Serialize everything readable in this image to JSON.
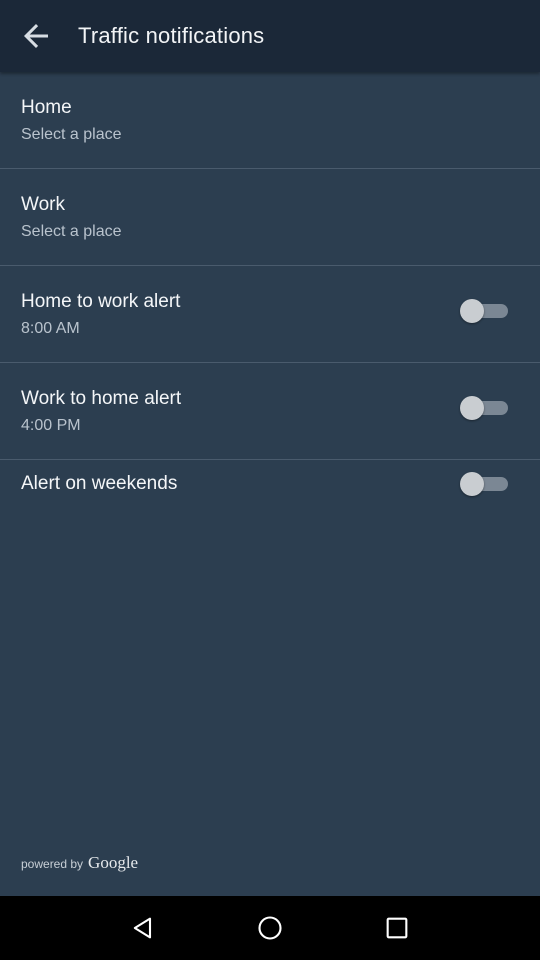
{
  "header": {
    "title": "Traffic notifications",
    "back_icon": "arrow-left-icon"
  },
  "settings": [
    {
      "id": "home",
      "primary": "Home",
      "secondary": "Select a place",
      "has_toggle": false
    },
    {
      "id": "work",
      "primary": "Work",
      "secondary": "Select a place",
      "has_toggle": false
    },
    {
      "id": "home-to-work-alert",
      "primary": "Home to work alert",
      "secondary": "8:00 AM",
      "has_toggle": true,
      "toggle_on": false
    },
    {
      "id": "work-to-home-alert",
      "primary": "Work to home alert",
      "secondary": "4:00 PM",
      "has_toggle": true,
      "toggle_on": false
    },
    {
      "id": "alert-on-weekends",
      "primary": "Alert on weekends",
      "has_toggle": true,
      "toggle_on": false
    }
  ],
  "footer": {
    "powered_by": "powered by",
    "logo_text": "Google"
  },
  "navigation": {
    "back_icon": "triangle-back-icon",
    "home_icon": "circle-home-icon",
    "recents_icon": "square-recents-icon"
  },
  "colors": {
    "background": "#2c3e50",
    "app_bar": "#1b2838",
    "divider": "#4a5b6d",
    "toggle_track_off": "#7b8794",
    "toggle_thumb_off": "#c9cdd1"
  }
}
